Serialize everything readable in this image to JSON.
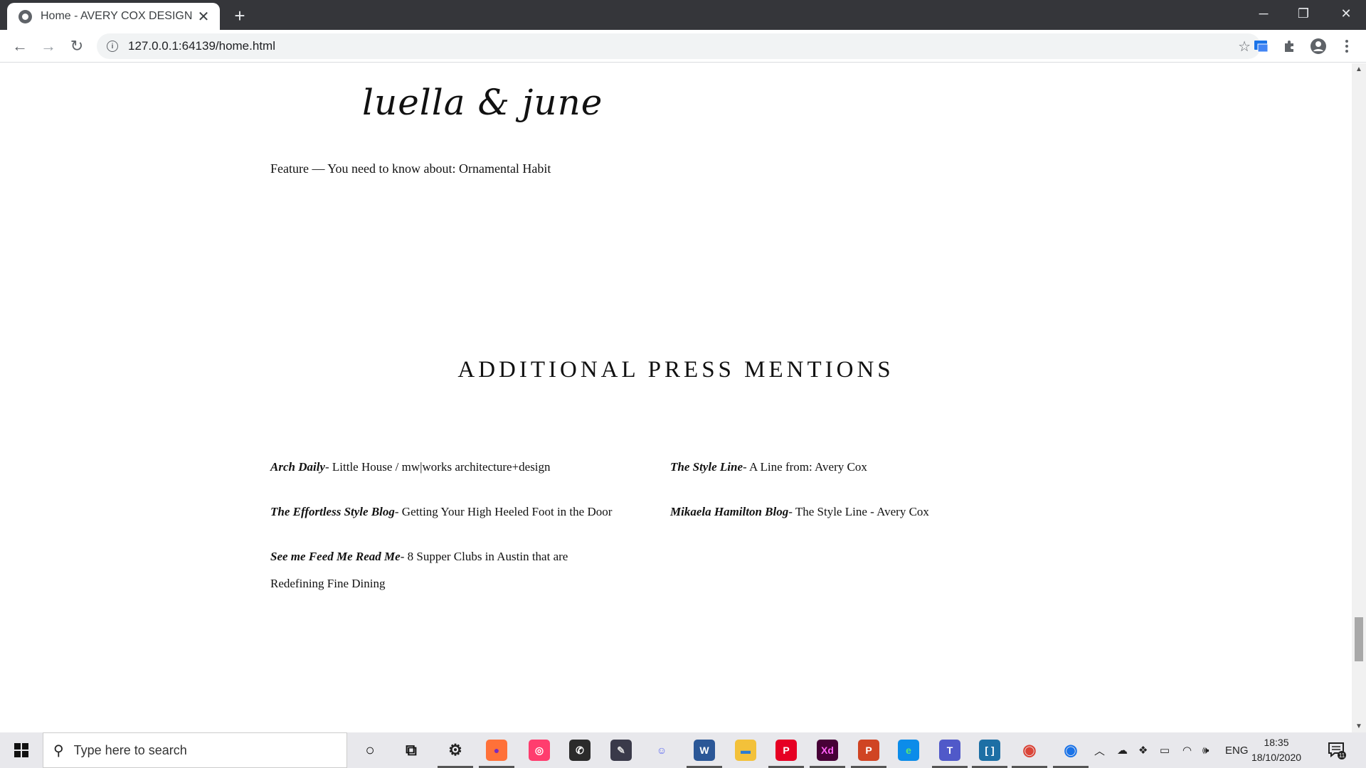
{
  "browser": {
    "tab_title": "Home - AVERY COX DESIGN",
    "tab_close": "✕",
    "new_tab": "+",
    "url": "127.0.0.1:64139/home.html",
    "info_glyph": "i",
    "star_glyph": "☆",
    "minimize": "─",
    "restore": "❐",
    "close": "✕",
    "back": "←",
    "forward": "→",
    "reload": "↻"
  },
  "page": {
    "logo_text": "luella & june",
    "feature_line": "Feature — You need to know about: Ornamental Habit",
    "press_heading": "ADDITIONAL PRESS MENTIONS",
    "mentions_left": [
      {
        "source": "Arch Daily",
        "title": "- Little House / mw|works architecture+design"
      },
      {
        "source": "The Effortless Style Blog",
        "title": "- Getting Your High Heeled Foot in the Door"
      },
      {
        "source": "See me Feed Me Read Me",
        "title": "- 8 Supper Clubs in Austin that are Redefining Fine Dining"
      }
    ],
    "mentions_right": [
      {
        "source": "The Style Line",
        "title": "- A Line from: Avery Cox"
      },
      {
        "source": "Mikaela Hamilton Blog",
        "title": "- The Style Line - Avery Cox"
      }
    ]
  },
  "taskbar": {
    "search_placeholder": "Type here to search",
    "language": "ENG",
    "time": "18:35",
    "date": "18/10/2020",
    "notification_count": "11",
    "icons": [
      {
        "name": "cortana-icon",
        "glyph": "○",
        "color": "#e8e8ec",
        "fg": "#111"
      },
      {
        "name": "task-view-icon",
        "glyph": "⧉",
        "color": "#e8e8ec",
        "fg": "#111"
      },
      {
        "name": "settings-icon",
        "glyph": "⚙",
        "color": "#e8e8ec",
        "fg": "#222"
      },
      {
        "name": "firefox-icon",
        "glyph": "●",
        "color": "#ff7139",
        "fg": "#7b2cbf"
      },
      {
        "name": "creative-cloud-icon",
        "glyph": "◎",
        "color": "#ff3d6e",
        "fg": "#fff"
      },
      {
        "name": "whatsapp-icon",
        "glyph": "✆",
        "color": "#2b2b2b",
        "fg": "#fff"
      },
      {
        "name": "pen-app-icon",
        "glyph": "✎",
        "color": "#3a3a4a",
        "fg": "#ddd"
      },
      {
        "name": "discord-icon",
        "glyph": "☺",
        "color": "#e8e8ec",
        "fg": "#5865f2"
      },
      {
        "name": "word-icon",
        "glyph": "W",
        "color": "#2b5797",
        "fg": "#fff"
      },
      {
        "name": "file-explorer-icon",
        "glyph": "▬",
        "color": "#f3c13a",
        "fg": "#2b7cd3"
      },
      {
        "name": "pinterest-icon",
        "glyph": "P",
        "color": "#e60023",
        "fg": "#fff"
      },
      {
        "name": "adobe-xd-icon",
        "glyph": "Xd",
        "color": "#470137",
        "fg": "#ff61f6"
      },
      {
        "name": "powerpoint-icon",
        "glyph": "P",
        "color": "#d04423",
        "fg": "#fff"
      },
      {
        "name": "edge-icon",
        "glyph": "e",
        "color": "#0c8ce9",
        "fg": "#5ee86f"
      },
      {
        "name": "teams-icon",
        "glyph": "T",
        "color": "#5059c9",
        "fg": "#fff"
      },
      {
        "name": "brackets-icon",
        "glyph": "[ ]",
        "color": "#1d6fa5",
        "fg": "#fff"
      },
      {
        "name": "chrome-profile-icon",
        "glyph": "◉",
        "color": "#e8e8ec",
        "fg": "#db4437"
      },
      {
        "name": "chrome-icon",
        "glyph": "◉",
        "color": "#e8e8ec",
        "fg": "#1a73e8"
      }
    ]
  }
}
